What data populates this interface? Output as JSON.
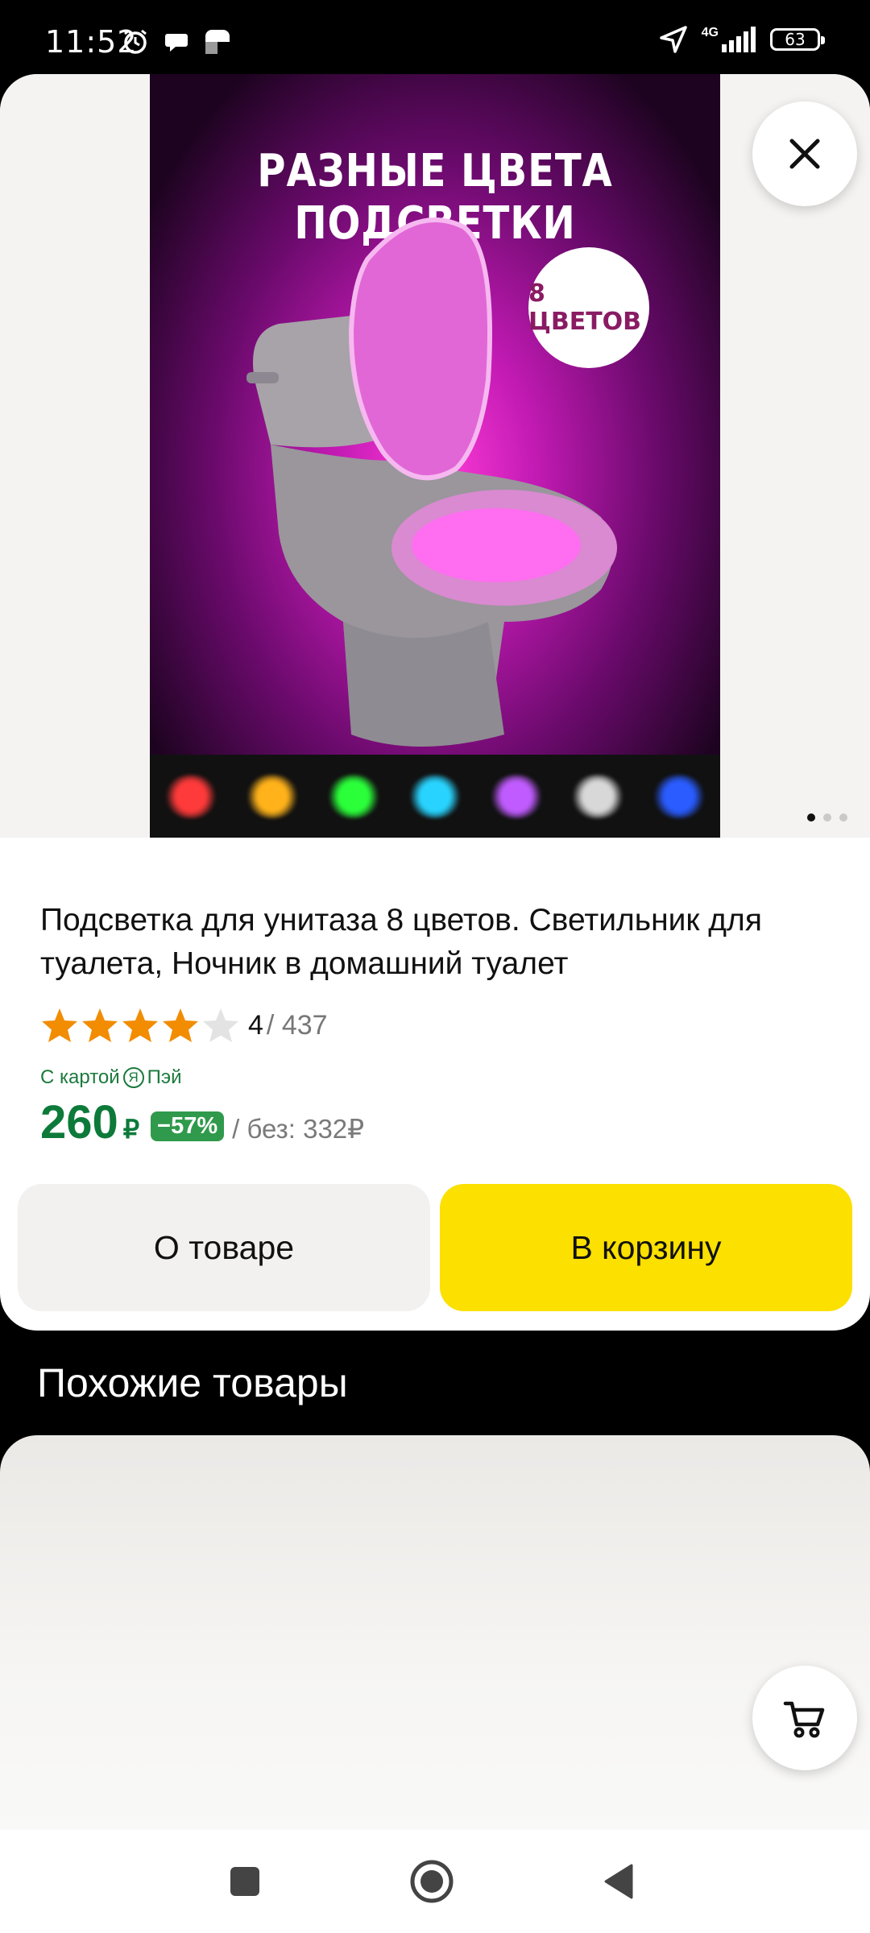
{
  "status_bar": {
    "time": "11:52",
    "network": "4G",
    "battery": "63"
  },
  "gallery": {
    "promo_text": "РАЗНЫЕ ЦВЕТА ПОДСВЕТКИ",
    "badge_text": "8 ЦВЕТОВ",
    "swatch_colors": [
      "#ff3a3a",
      "#ffb21a",
      "#2bff3a",
      "#28d4ff",
      "#c05cff",
      "#d8d8d8",
      "#2a5cff"
    ],
    "page_count": 3,
    "active_page": 1
  },
  "product": {
    "title": "Подсветка для унитаза 8 цветов. Светильник для туалета, Ночник в домашний туалет",
    "rating": "4",
    "rating_count": "/ 437",
    "rating_stars_filled": 4,
    "card_label_prefix": "С картой",
    "card_label_brand": "Я",
    "card_label_suffix": "Пэй",
    "price": "260",
    "currency": "₽",
    "discount": "−57%",
    "old_price": "/ без: 332₽"
  },
  "actions": {
    "about_label": "О товаре",
    "cart_label": "В корзину"
  },
  "similar": {
    "title": "Похожие товары"
  },
  "colors": {
    "price_green": "#0d7a3a",
    "discount_green": "#2f9a4b",
    "cart_yellow": "#fbe000",
    "star_orange": "#f28c00"
  },
  "icons": {
    "close": "close-icon",
    "cart": "cart-icon",
    "nav_recents": "square-icon",
    "nav_home": "circle-icon",
    "nav_back": "triangle-back-icon"
  }
}
